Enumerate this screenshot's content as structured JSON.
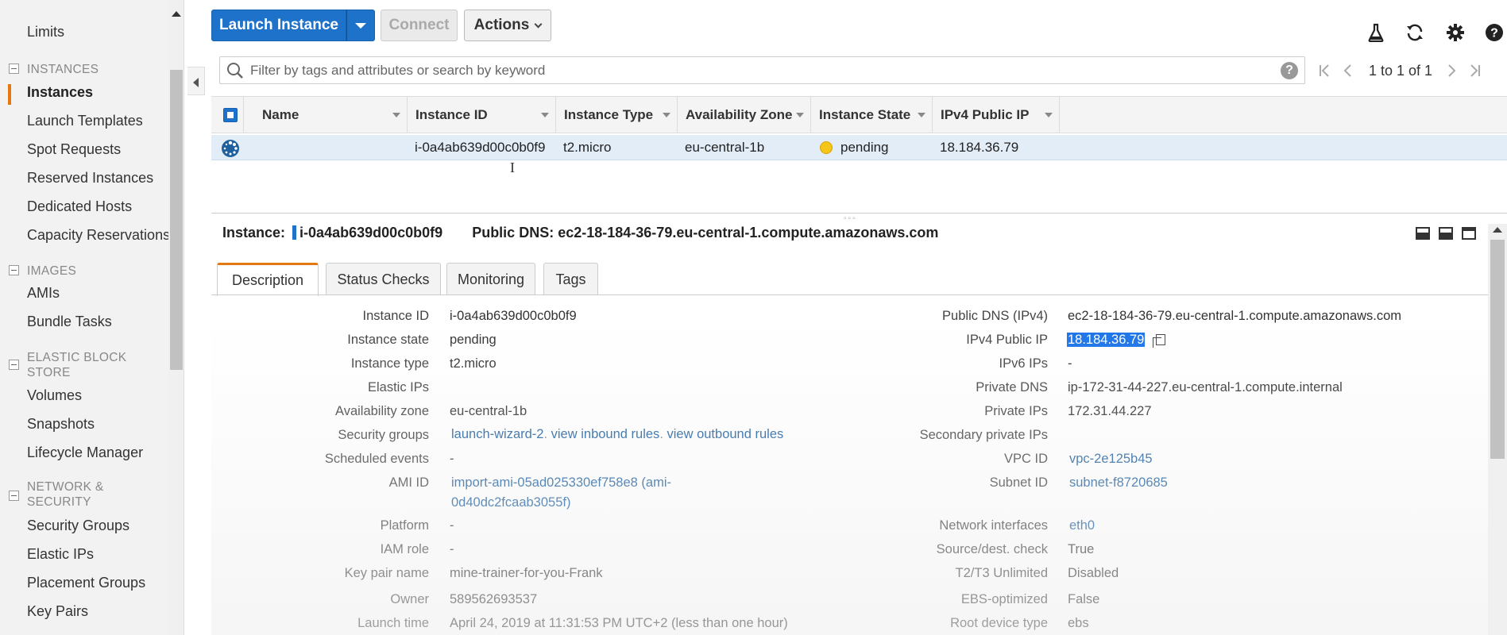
{
  "sidebar": {
    "items": {
      "limits": "Limits",
      "instances_section": "INSTANCES",
      "instances": "Instances",
      "launch_templates": "Launch Templates",
      "spot_requests": "Spot Requests",
      "reserved_instances": "Reserved Instances",
      "dedicated_hosts": "Dedicated Hosts",
      "capacity_reservations": "Capacity Reservations",
      "images_section": "IMAGES",
      "amis": "AMIs",
      "bundle_tasks": "Bundle Tasks",
      "ebs_section_1": "ELASTIC BLOCK",
      "ebs_section_2": "STORE",
      "volumes": "Volumes",
      "snapshots": "Snapshots",
      "lifecycle_manager": "Lifecycle Manager",
      "network_section_1": "NETWORK &",
      "network_section_2": "SECURITY",
      "security_groups": "Security Groups",
      "elastic_ips": "Elastic IPs",
      "placement_groups": "Placement Groups",
      "key_pairs": "Key Pairs"
    }
  },
  "toolbar": {
    "launch_label": "Launch Instance",
    "connect_label": "Connect",
    "actions_label": "Actions"
  },
  "search": {
    "placeholder": "Filter by tags and attributes or search by keyword",
    "help_label": "?"
  },
  "pager": {
    "text": "1 to 1 of 1"
  },
  "table": {
    "columns": {
      "name": "Name",
      "instance_id": "Instance ID",
      "instance_type": "Instance Type",
      "availability_zone": "Availability Zone",
      "instance_state": "Instance State",
      "ipv4_public_ip": "IPv4 Public IP"
    },
    "row": {
      "name": "",
      "instance_id": "i-0a4ab639d00c0b0f9",
      "instance_type": "t2.micro",
      "availability_zone": "eu-central-1b",
      "instance_state": "pending",
      "ipv4_public_ip": "18.184.36.79"
    }
  },
  "detail": {
    "instance_label": "Instance:",
    "instance_id": "i-0a4ab639d00c0b0f9",
    "dns_label": "Public DNS:",
    "dns_value": "ec2-18-184-36-79.eu-central-1.compute.amazonaws.com",
    "tabs": {
      "description": "Description",
      "status_checks": "Status Checks",
      "monitoring": "Monitoring",
      "tags": "Tags"
    },
    "left": {
      "instance_id_label": "Instance ID",
      "instance_id": "i-0a4ab639d00c0b0f9",
      "instance_state_label": "Instance state",
      "instance_state": "pending",
      "instance_type_label": "Instance type",
      "instance_type": "t2.micro",
      "elastic_ips_label": "Elastic IPs",
      "availability_zone_label": "Availability zone",
      "availability_zone": "eu-central-1b",
      "security_groups_label": "Security groups",
      "security_group": "launch-wizard-2",
      "view_inbound": "view inbound rules",
      "view_outbound": "view outbound rules",
      "scheduled_events_label": "Scheduled events",
      "scheduled_events": "-",
      "ami_id_label": "AMI ID",
      "ami_id_line1": "import-ami-05ad025330ef758e8 (ami-",
      "ami_id_line2": "0d40dc2fcaab3055f)",
      "platform_label": "Platform",
      "platform": "-",
      "iam_role_label": "IAM role",
      "iam_role": "-",
      "key_pair_label": "Key pair name",
      "key_pair": "mine-trainer-for-you-Frank",
      "owner_label": "Owner",
      "owner": "589562693537",
      "launch_time_label": "Launch time",
      "launch_time": "April 24, 2019 at 11:31:53 PM UTC+2 (less than one hour)"
    },
    "right": {
      "public_dns_label": "Public DNS (IPv4)",
      "public_dns": "ec2-18-184-36-79.eu-central-1.compute.amazonaws.com",
      "ipv4_public_ip_label": "IPv4 Public IP",
      "ipv4_public_ip": "18.184.36.79",
      "ipv6_label": "IPv6 IPs",
      "ipv6": "-",
      "private_dns_label": "Private DNS",
      "private_dns": "ip-172-31-44-227.eu-central-1.compute.internal",
      "private_ips_label": "Private IPs",
      "private_ips": "172.31.44.227",
      "secondary_private_ips_label": "Secondary private IPs",
      "vpc_id_label": "VPC ID",
      "vpc_id": "vpc-2e125b45",
      "subnet_id_label": "Subnet ID",
      "subnet_id": "subnet-f8720685",
      "network_interfaces_label": "Network interfaces",
      "network_interfaces": "eth0",
      "source_dest_label": "Source/dest. check",
      "source_dest": "True",
      "t2t3_label": "T2/T3 Unlimited",
      "t2t3": "Disabled",
      "ebs_optimized_label": "EBS-optimized",
      "ebs_optimized": "False",
      "root_device_label": "Root device type",
      "root_device": "ebs"
    }
  },
  "colors": {
    "primary_button": "#1e72c9",
    "active_tab_accent": "#e47911",
    "pending_state": "#f5c518",
    "selection_highlight": "#1a73e8"
  },
  "icons": {
    "flask": "flask-icon",
    "refresh": "refresh-icon",
    "settings": "gear-icon",
    "help": "help-icon"
  }
}
